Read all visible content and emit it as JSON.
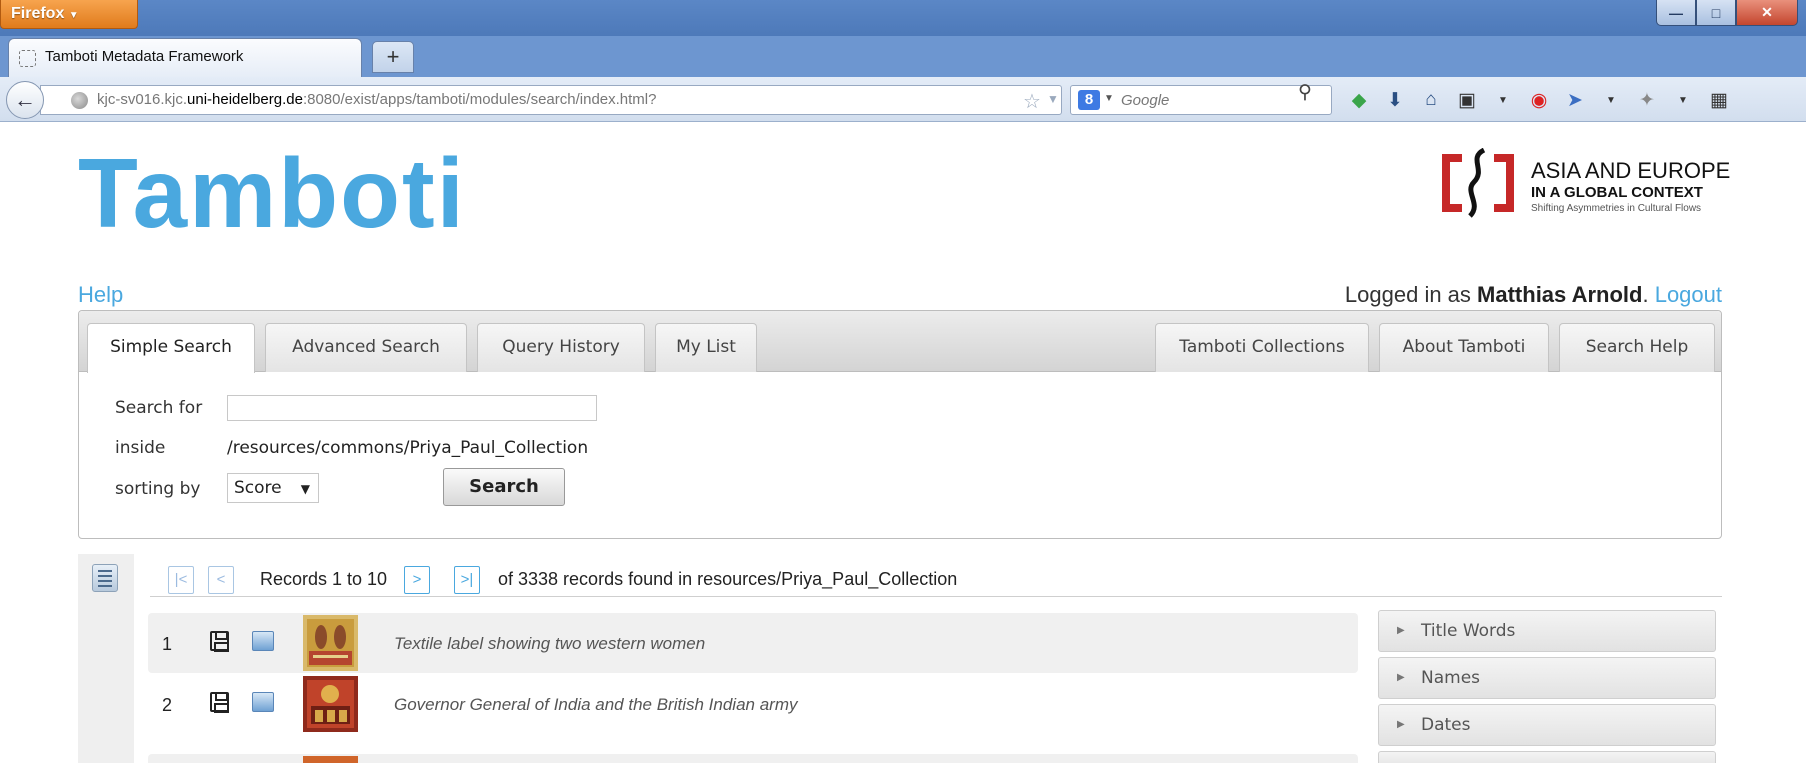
{
  "browser": {
    "menu_button": "Firefox",
    "tab_title": "Tamboti Metadata Framework",
    "new_tab": "+",
    "url_prefix": "kjc-sv016.kjc.",
    "url_host": "uni-heidelberg.de",
    "url_suffix": ":8080/exist/apps/tamboti/modules/search/index.html?",
    "search_engine_placeholder": "Google"
  },
  "header": {
    "logo": "Tamboti",
    "partner_line1": "ASIA AND EUROPE",
    "partner_line2": "IN A GLOBAL CONTEXT",
    "partner_line3": "Shifting Asymmetries in Cultural Flows"
  },
  "topbar": {
    "help": "Help",
    "logged_in_prefix": "Logged in as",
    "user_name": "Matthias Arnold",
    "logout": "Logout"
  },
  "tabs": {
    "left": [
      "Simple Search",
      "Advanced Search",
      "Query History",
      "My List"
    ],
    "right": [
      "Tamboti Collections",
      "About Tamboti",
      "Search Help"
    ],
    "active": "Simple Search"
  },
  "search_form": {
    "search_for_label": "Search for",
    "search_for_value": "",
    "inside_label": "inside",
    "inside_value": "/resources/commons/Priya_Paul_Collection",
    "sorting_label": "sorting by",
    "sorting_value": "Score",
    "search_button": "Search"
  },
  "pager": {
    "first": "|<",
    "prev": "<",
    "records_text": "Records 1 to 10",
    "next": ">",
    "last": ">|",
    "found_text": "of 3338 records found in resources/Priya_Paul_Collection"
  },
  "results": [
    {
      "num": "1",
      "title": "Textile label showing two western women"
    },
    {
      "num": "2",
      "title": "Governor General of India and the British Indian army"
    }
  ],
  "facets": [
    "Title Words",
    "Names",
    "Dates"
  ],
  "colors": {
    "brand_blue": "#4aa8df",
    "partner_red": "#c62828"
  }
}
